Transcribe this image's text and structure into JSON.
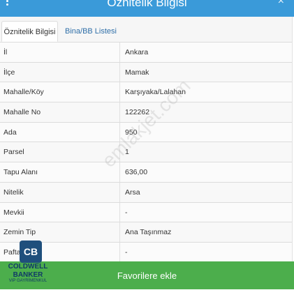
{
  "header": {
    "title": "Öznitelik Bilgisi",
    "close_label": "×"
  },
  "tabs": [
    {
      "label": "Öznitelik Bilgisi"
    },
    {
      "label": "Bina/BB Listesi"
    }
  ],
  "rows": [
    {
      "key": "İl",
      "value": "Ankara"
    },
    {
      "key": "İlçe",
      "value": "Mamak"
    },
    {
      "key": "Mahalle/Köy",
      "value": "Karşıyaka/Lalahan"
    },
    {
      "key": "Mahalle No",
      "value": "122262"
    },
    {
      "key": "Ada",
      "value": "950"
    },
    {
      "key": "Parsel",
      "value": "1"
    },
    {
      "key": "Tapu Alanı",
      "value": "636,00"
    },
    {
      "key": "Nitelik",
      "value": "Arsa"
    },
    {
      "key": "Mevkii",
      "value": "-"
    },
    {
      "key": "Zemin Tip",
      "value": "Ana Taşınmaz"
    },
    {
      "key": "Pafta",
      "value": "-"
    }
  ],
  "watermark": "emlakjet.com",
  "favorite_button": {
    "label": "Favorilere ekle"
  },
  "logo": {
    "mark": "CB",
    "line1": "COLDWELL",
    "line2": "BANKER",
    "line3": "VIP GAYRİMENKUL"
  }
}
